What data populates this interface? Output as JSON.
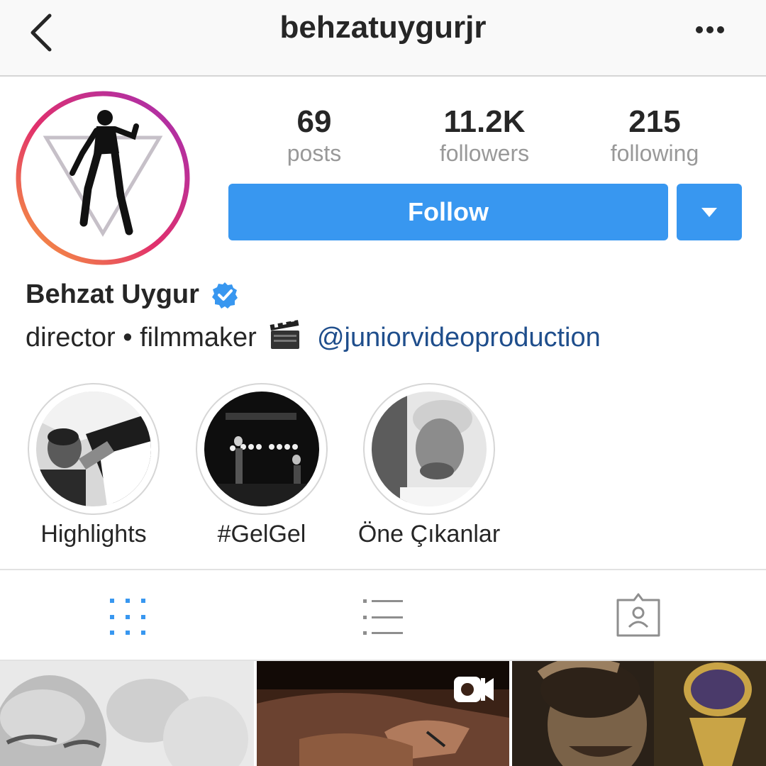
{
  "header": {
    "username": "behzatuygurjr",
    "back_icon": "chevron-left-icon",
    "more_icon": "more-horizontal-icon"
  },
  "stats": [
    {
      "value": "69",
      "label": "posts"
    },
    {
      "value": "11.2K",
      "label": "followers"
    },
    {
      "value": "215",
      "label": "following"
    }
  ],
  "actions": {
    "follow_label": "Follow",
    "dropdown_icon": "caret-down-icon"
  },
  "bio": {
    "full_name": "Behzat Uygur",
    "verified": true,
    "text": "director • filmmaker",
    "emoji_icon": "clapper-board-icon",
    "mention": "@juniorvideoproduction"
  },
  "highlights": [
    {
      "label": "Highlights"
    },
    {
      "label": "#GelGel"
    },
    {
      "label": "Öne Çıkanlar"
    }
  ],
  "tabs": [
    {
      "icon": "grid-icon",
      "active": true
    },
    {
      "icon": "list-icon",
      "active": false
    },
    {
      "icon": "tagged-user-icon",
      "active": false
    }
  ],
  "colors": {
    "accent": "#3897f0",
    "mention": "#1f4e8c",
    "muted": "#999999",
    "text": "#262626"
  }
}
